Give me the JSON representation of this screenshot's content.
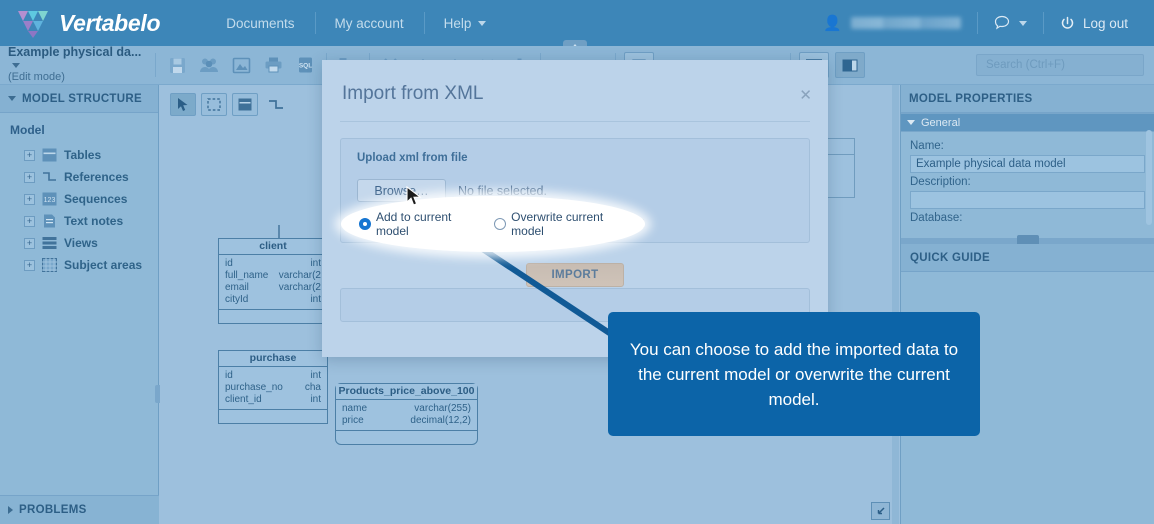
{
  "topnav": {
    "brand": "Vertabelo",
    "links": [
      {
        "label": "Documents",
        "caret": false
      },
      {
        "label": "My account",
        "caret": false
      },
      {
        "label": "Help",
        "caret": true
      }
    ],
    "user_icon": "user-icon",
    "username_redacted": "",
    "chat_icon": "chat-bubble-icon",
    "power_icon": "power-icon",
    "logout_label": "Log out"
  },
  "toolbar": {
    "doc_title": "Example physical da...",
    "doc_mode": "(Edit mode)",
    "icons": [
      "save-icon",
      "share-users-icon",
      "export-image-icon",
      "print-icon",
      "sql-script-icon",
      "xml-import-icon",
      "cut-icon",
      "copy-icon",
      "paste-icon",
      "merge-icon",
      "delete-icon",
      "align-left-icon",
      "align-right-icon",
      "fit-screen-icon",
      "zoom-out-icon",
      "zoom-in-icon",
      "grid-icon",
      "snap-icon"
    ],
    "view_toggles": [
      "panel-layout-icon",
      "panel-split-icon"
    ],
    "search_placeholder": "Search (Ctrl+F)",
    "search_value": ""
  },
  "left_panel": {
    "header": "MODEL STRUCTURE",
    "root": "Model",
    "items": [
      {
        "label": "Tables",
        "icon": "table-icon",
        "expander": "+"
      },
      {
        "label": "References",
        "icon": "reference-icon",
        "expander": "+"
      },
      {
        "label": "Sequences",
        "icon": "sequence-icon",
        "expander": "+"
      },
      {
        "label": "Text notes",
        "icon": "note-icon",
        "expander": "+"
      },
      {
        "label": "Views",
        "icon": "view-icon",
        "expander": "+"
      },
      {
        "label": "Subject areas",
        "icon": "subject-area-icon",
        "expander": "+"
      }
    ],
    "problems": "PROBLEMS"
  },
  "canvas": {
    "tools": [
      {
        "name": "pointer-tool",
        "active": true
      },
      {
        "name": "marquee-select-tool",
        "active": false
      },
      {
        "name": "new-table-tool",
        "active": false
      },
      {
        "name": "new-reference-tool",
        "active": false
      }
    ],
    "fit_icon": "fit-to-screen-icon",
    "tables": [
      {
        "name": "client",
        "columns": [
          {
            "name": "id",
            "type": "int"
          },
          {
            "name": "full_name",
            "type": "varchar(2"
          },
          {
            "name": "email",
            "type": "varchar(2"
          },
          {
            "name": "cityId",
            "type": "int"
          }
        ]
      },
      {
        "name": "purchase",
        "columns": [
          {
            "name": "id",
            "type": "int"
          },
          {
            "name": "purchase_no",
            "type": "cha"
          },
          {
            "name": "client_id",
            "type": "int"
          }
        ]
      },
      {
        "name": "Products_price_above_100",
        "columns": [
          {
            "name": "name",
            "type": "varchar(255)"
          },
          {
            "name": "price",
            "type": "decimal(12,2)"
          }
        ]
      }
    ]
  },
  "right_panel": {
    "header": "MODEL PROPERTIES",
    "general_section": "General",
    "fields": [
      {
        "label": "Name:",
        "value": "Example physical data model"
      },
      {
        "label": "Description:",
        "value": ""
      }
    ],
    "database_label": "Database:",
    "quick_guide": "QUICK GUIDE"
  },
  "modal": {
    "title": "Import from XML",
    "close_icon": "close-icon",
    "upload_legend": "Upload xml from file",
    "browse_label": "Browse…",
    "no_file_label": "No file selected.",
    "radio_options": [
      {
        "label": "Add to current model",
        "checked": true
      },
      {
        "label": "Overwrite current model",
        "checked": false
      }
    ],
    "import_label": "IMPORT"
  },
  "annotation": {
    "callout_text": "You can choose to add the imported data to the current model or overwrite the current model.",
    "callout_color": "#0c64a8",
    "cursor_icon": "mouse-pointer-icon"
  }
}
